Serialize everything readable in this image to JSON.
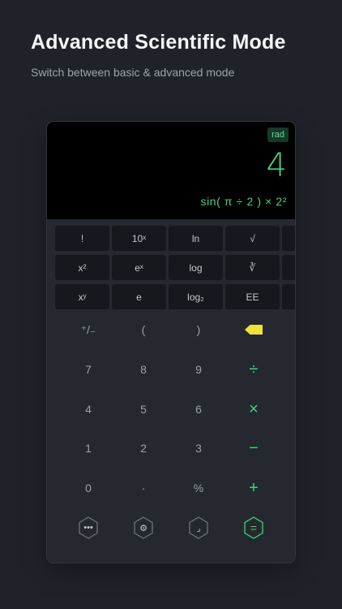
{
  "header": {
    "title": "Advanced Scientific Mode",
    "subtitle": "Switch between basic & advanced mode"
  },
  "display": {
    "mode": "rad",
    "result": "4",
    "expression": "sin( π ÷ 2 ) × 2²"
  },
  "scientific_keys": [
    [
      "!",
      "10ˣ",
      "ln",
      "√"
    ],
    [
      "x²",
      "eˣ",
      "log",
      "∛"
    ],
    [
      "xʸ",
      "e",
      "log₂",
      "EE"
    ]
  ],
  "keypad": {
    "row1": [
      "⁺/₋",
      "(",
      ")"
    ],
    "row2": [
      "7",
      "8",
      "9",
      "÷"
    ],
    "row3": [
      "4",
      "5",
      "6",
      "×"
    ],
    "row4": [
      "1",
      "2",
      "3",
      "−"
    ],
    "row5": [
      "0",
      "·",
      "%",
      "+"
    ]
  },
  "bottom_bar": [
    "•••",
    "⚙",
    "⌟",
    "="
  ],
  "colors": {
    "accent": "#3ed57a",
    "backspace": "#f0e23a",
    "display_bg": "#000000",
    "page_bg": "#1f2329"
  },
  "icons": {
    "backspace": "backspace-icon",
    "more": "more-icon",
    "settings": "gear-icon",
    "history": "history-icon",
    "equals": "equals-icon"
  }
}
